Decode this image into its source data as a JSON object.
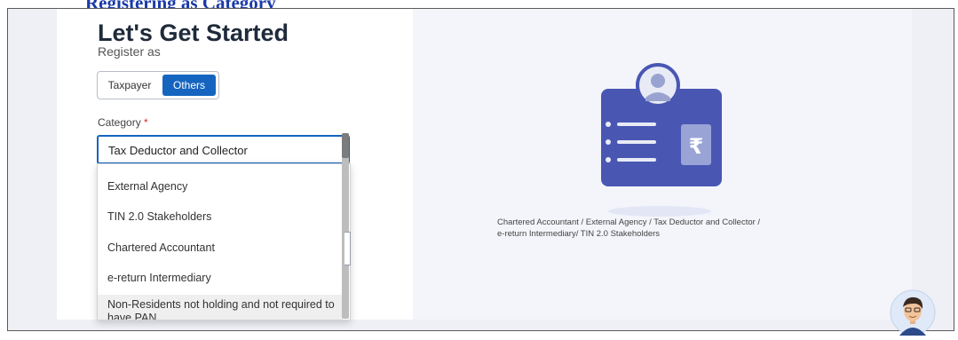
{
  "top_banner_text": "Registering as Category",
  "heading": "Let's Get Started",
  "subheading": "Register as",
  "register_toggle": {
    "taxpayer": "Taxpayer",
    "others": "Others",
    "selected": "Others"
  },
  "category": {
    "label": "Category",
    "required_mark": "*",
    "selected": "Tax Deductor and Collector",
    "options": [
      "External Agency",
      "TIN 2.0 Stakeholders",
      "Chartered Accountant",
      "e-return Intermediary",
      "Non-Residents not holding and not required to have PAN"
    ],
    "option_lines": [
      [
        "External Agency"
      ],
      [
        "TIN 2.0 Stakeholders"
      ],
      [
        "Chartered Accountant"
      ],
      [
        "e-return Intermediary"
      ],
      [
        "Non-Residents not holding and not required to",
        "have PAN"
      ]
    ]
  },
  "illustration": {
    "icon": "id-card-rupee-icon",
    "caption_line1": "Chartered Accountant / External Agency / Tax Deductor and Collector /",
    "caption_line2": "e-return Intermediary/ TIN 2.0 Stakeholders"
  },
  "chat_icon": "chatbot-avatar-icon",
  "colors": {
    "accent": "#1565c0",
    "card": "#4957b3",
    "card_dark": "#3d4aa3",
    "required": "#d32f2f"
  }
}
